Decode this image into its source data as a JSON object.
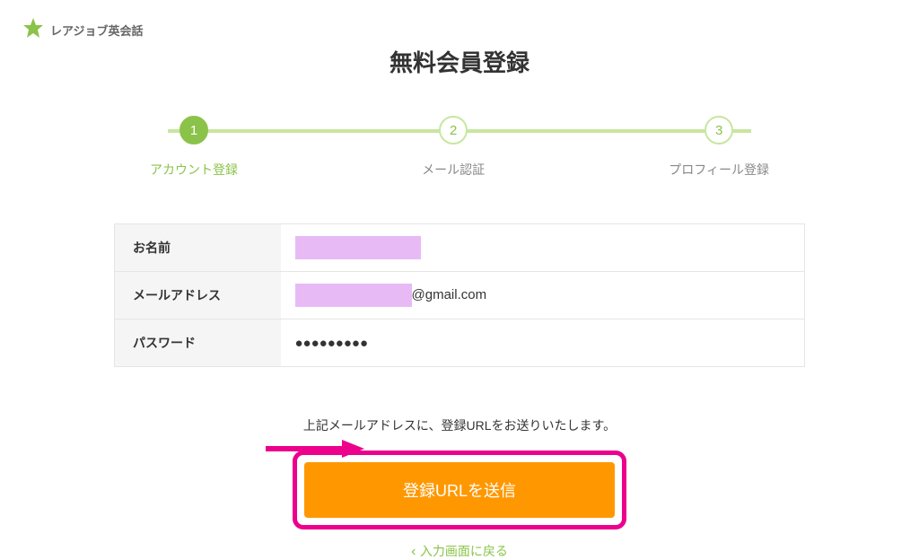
{
  "brand": {
    "name": "レアジョブ英会話"
  },
  "page": {
    "title": "無料会員登録",
    "progress_steps": [
      {
        "number": "1",
        "label": "アカウント登録",
        "active": true
      },
      {
        "number": "2",
        "label": "メール認証",
        "active": false
      },
      {
        "number": "3",
        "label": "プロフィール登録",
        "active": false
      }
    ]
  },
  "form": {
    "name_label": "お名前",
    "name_value": "",
    "email_label": "メールアドレス",
    "email_value_suffix": "@gmail.com",
    "password_label": "パスワード",
    "password_value": "●●●●●●●●●"
  },
  "footer": {
    "note": "上記メールアドレスに、登録URLをお送りいたします。",
    "submit_label": "登録URLを送信",
    "back_label": "入力画面に戻る"
  },
  "colors": {
    "accent_green": "#8bc34a",
    "accent_orange": "#ff9800",
    "annotation_pink": "#ec008c",
    "redaction": "#e8baf5"
  }
}
